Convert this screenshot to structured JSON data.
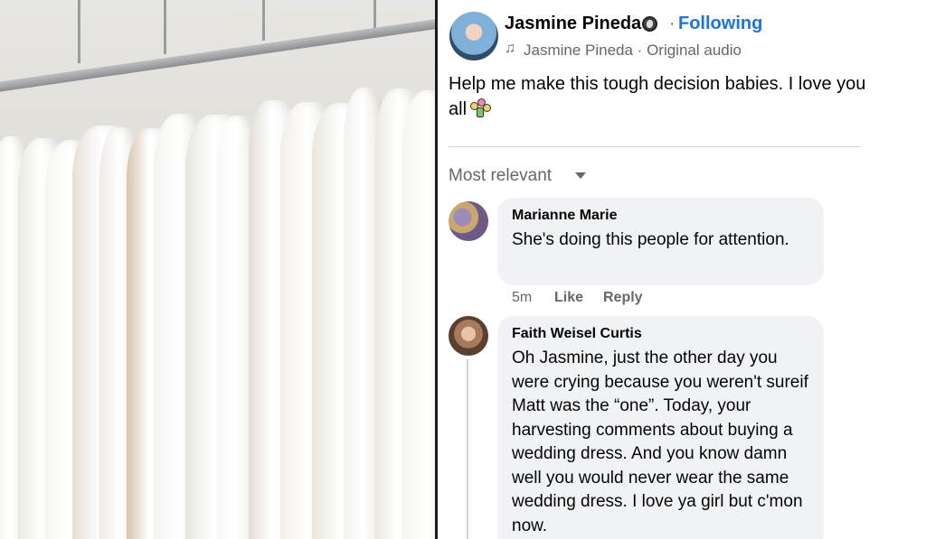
{
  "post": {
    "author_name": "Jasmine Pineda",
    "follow_status": "Following",
    "separator": "·",
    "audio_label": "Jasmine Pineda · Original audio",
    "icons": [
      "globe-icon",
      "music-note-icon",
      "bouquet-emoji-icon",
      "chevron-down-icon"
    ],
    "text": "Help me make this tough decision babies. I love you all"
  },
  "comments_section": {
    "sort_label": "Most relevant"
  },
  "comments": [
    {
      "author": "Marianne Marie",
      "text": "She's doing this people for attention.",
      "time": "5m",
      "like_label": "Like",
      "reply_label": "Reply"
    },
    {
      "author": "Faith Weisel Curtis",
      "text": "Oh Jasmine, just the other day you were crying because you weren't sureif Matt was the “one”. Today, your harvesting comments about buying a wedding dress. And you know damn well you would never wear the same wedding dress. I love ya girl but c'mon now."
    }
  ]
}
